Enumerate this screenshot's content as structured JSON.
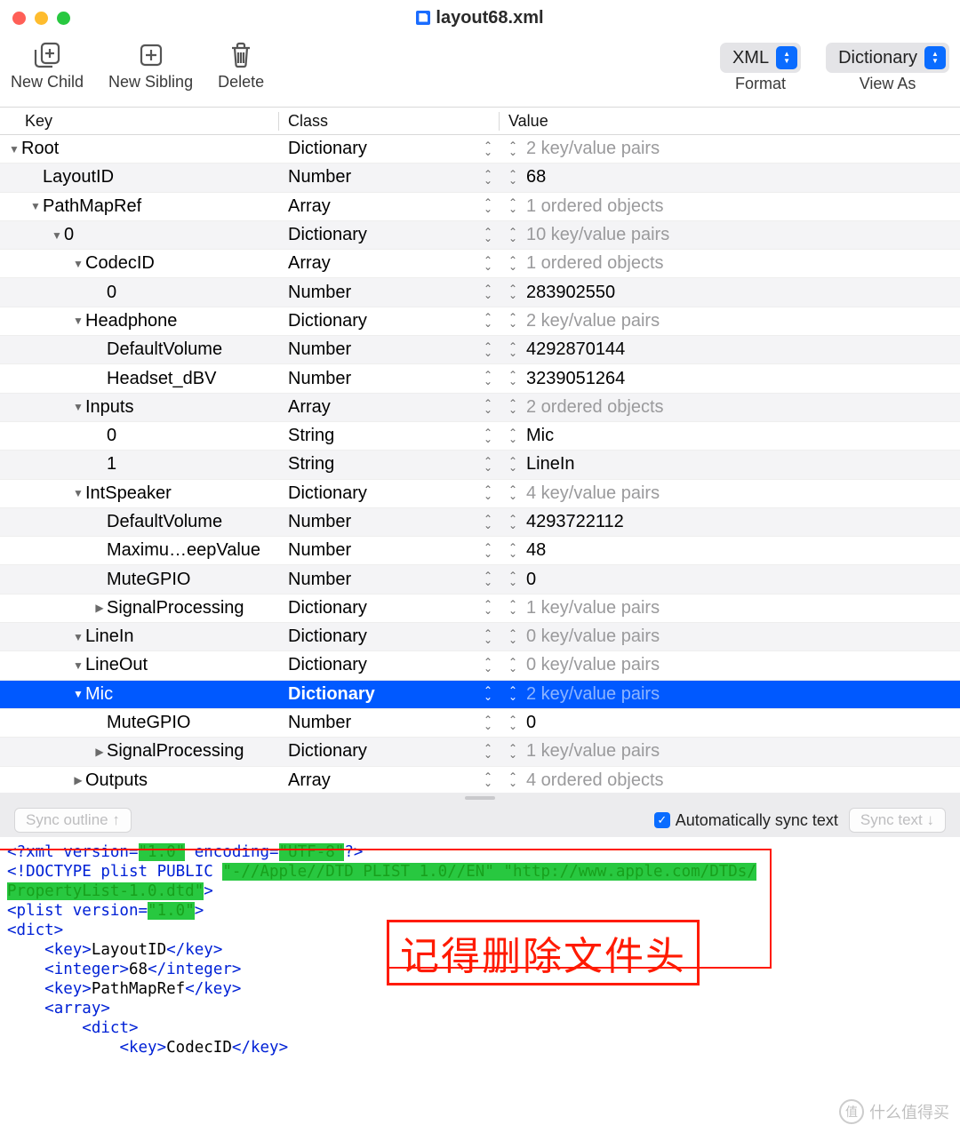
{
  "window": {
    "title": "layout68.xml"
  },
  "toolbar": {
    "new_child": "New Child",
    "new_sibling": "New Sibling",
    "delete": "Delete",
    "format_label": "Format",
    "format_value": "XML",
    "viewas_label": "View As",
    "viewas_value": "Dictionary"
  },
  "columns": {
    "key": "Key",
    "class": "Class",
    "value": "Value"
  },
  "rows": [
    {
      "indent": 0,
      "disclosure": "down",
      "key": "Root",
      "class": "Dictionary",
      "value": "2 key/value pairs",
      "muted": true,
      "selected": false
    },
    {
      "indent": 1,
      "disclosure": "",
      "key": "LayoutID",
      "class": "Number",
      "value": "68",
      "muted": false,
      "selected": false
    },
    {
      "indent": 1,
      "disclosure": "down",
      "key": "PathMapRef",
      "class": "Array",
      "value": "1 ordered objects",
      "muted": true,
      "selected": false
    },
    {
      "indent": 2,
      "disclosure": "down",
      "key": "0",
      "class": "Dictionary",
      "value": "10 key/value pairs",
      "muted": true,
      "selected": false
    },
    {
      "indent": 3,
      "disclosure": "down",
      "key": "CodecID",
      "class": "Array",
      "value": "1 ordered objects",
      "muted": true,
      "selected": false
    },
    {
      "indent": 4,
      "disclosure": "",
      "key": "0",
      "class": "Number",
      "value": "283902550",
      "muted": false,
      "selected": false
    },
    {
      "indent": 3,
      "disclosure": "down",
      "key": "Headphone",
      "class": "Dictionary",
      "value": "2 key/value pairs",
      "muted": true,
      "selected": false
    },
    {
      "indent": 4,
      "disclosure": "",
      "key": "DefaultVolume",
      "class": "Number",
      "value": "4292870144",
      "muted": false,
      "selected": false
    },
    {
      "indent": 4,
      "disclosure": "",
      "key": "Headset_dBV",
      "class": "Number",
      "value": "3239051264",
      "muted": false,
      "selected": false
    },
    {
      "indent": 3,
      "disclosure": "down",
      "key": "Inputs",
      "class": "Array",
      "value": "2 ordered objects",
      "muted": true,
      "selected": false
    },
    {
      "indent": 4,
      "disclosure": "",
      "key": "0",
      "class": "String",
      "value": "Mic",
      "muted": false,
      "selected": false
    },
    {
      "indent": 4,
      "disclosure": "",
      "key": "1",
      "class": "String",
      "value": "LineIn",
      "muted": false,
      "selected": false
    },
    {
      "indent": 3,
      "disclosure": "down",
      "key": "IntSpeaker",
      "class": "Dictionary",
      "value": "4 key/value pairs",
      "muted": true,
      "selected": false
    },
    {
      "indent": 4,
      "disclosure": "",
      "key": "DefaultVolume",
      "class": "Number",
      "value": "4293722112",
      "muted": false,
      "selected": false
    },
    {
      "indent": 4,
      "disclosure": "",
      "key": "Maximu…eepValue",
      "class": "Number",
      "value": "48",
      "muted": false,
      "selected": false
    },
    {
      "indent": 4,
      "disclosure": "",
      "key": "MuteGPIO",
      "class": "Number",
      "value": "0",
      "muted": false,
      "selected": false
    },
    {
      "indent": 4,
      "disclosure": "right",
      "key": "SignalProcessing",
      "class": "Dictionary",
      "value": "1 key/value pairs",
      "muted": true,
      "selected": false
    },
    {
      "indent": 3,
      "disclosure": "down",
      "key": "LineIn",
      "class": "Dictionary",
      "value": "0 key/value pairs",
      "muted": true,
      "selected": false
    },
    {
      "indent": 3,
      "disclosure": "down",
      "key": "LineOut",
      "class": "Dictionary",
      "value": "0 key/value pairs",
      "muted": true,
      "selected": false
    },
    {
      "indent": 3,
      "disclosure": "down",
      "key": "Mic",
      "class": "Dictionary",
      "value": "2 key/value pairs",
      "muted": true,
      "selected": true
    },
    {
      "indent": 4,
      "disclosure": "",
      "key": "MuteGPIO",
      "class": "Number",
      "value": "0",
      "muted": false,
      "selected": false
    },
    {
      "indent": 4,
      "disclosure": "right",
      "key": "SignalProcessing",
      "class": "Dictionary",
      "value": "1 key/value pairs",
      "muted": true,
      "selected": false
    },
    {
      "indent": 3,
      "disclosure": "right",
      "key": "Outputs",
      "class": "Array",
      "value": "4 ordered objects",
      "muted": true,
      "selected": false
    }
  ],
  "sync_bar": {
    "sync_outline": "Sync outline ↑",
    "auto_label": "Automatically sync text",
    "auto_checked": true,
    "sync_text": "Sync text ↓"
  },
  "code_lines": [
    {
      "parts": [
        {
          "c": "blue",
          "t": "<?xml version="
        },
        {
          "c": "green",
          "t": "\"1.0\""
        },
        {
          "c": "blue",
          "t": " encoding="
        },
        {
          "c": "green",
          "t": "\"UTF-8\""
        },
        {
          "c": "blue",
          "t": "?>"
        }
      ]
    },
    {
      "parts": [
        {
          "c": "blue",
          "t": "<!DOCTYPE plist PUBLIC "
        },
        {
          "c": "green",
          "t": "\"-//Apple//DTD PLIST 1.0//EN\" \"http://www.apple.com/DTDs/"
        }
      ]
    },
    {
      "parts": [
        {
          "c": "green",
          "t": "PropertyList-1.0.dtd\""
        },
        {
          "c": "blue",
          "t": ">"
        }
      ]
    },
    {
      "parts": [
        {
          "c": "blue",
          "t": "<plist version="
        },
        {
          "c": "green",
          "t": "\"1.0\""
        },
        {
          "c": "blue",
          "t": ">"
        }
      ]
    },
    {
      "parts": [
        {
          "c": "blue",
          "t": "<dict>"
        }
      ]
    },
    {
      "parts": [
        {
          "c": "black",
          "t": "    "
        },
        {
          "c": "blue",
          "t": "<key>"
        },
        {
          "c": "black",
          "t": "LayoutID"
        },
        {
          "c": "blue",
          "t": "</key>"
        }
      ]
    },
    {
      "parts": [
        {
          "c": "black",
          "t": "    "
        },
        {
          "c": "blue",
          "t": "<integer>"
        },
        {
          "c": "black",
          "t": "68"
        },
        {
          "c": "blue",
          "t": "</integer>"
        }
      ]
    },
    {
      "parts": [
        {
          "c": "black",
          "t": "    "
        },
        {
          "c": "blue",
          "t": "<key>"
        },
        {
          "c": "black",
          "t": "PathMapRef"
        },
        {
          "c": "blue",
          "t": "</key>"
        }
      ]
    },
    {
      "parts": [
        {
          "c": "black",
          "t": "    "
        },
        {
          "c": "blue",
          "t": "<array>"
        }
      ]
    },
    {
      "parts": [
        {
          "c": "black",
          "t": "        "
        },
        {
          "c": "blue",
          "t": "<dict>"
        }
      ]
    },
    {
      "parts": [
        {
          "c": "black",
          "t": "            "
        },
        {
          "c": "blue",
          "t": "<key>"
        },
        {
          "c": "black",
          "t": "CodecID"
        },
        {
          "c": "blue",
          "t": "</key>"
        }
      ]
    }
  ],
  "annotation": {
    "text": "记得删除文件头"
  },
  "watermark": {
    "text": "什么值得买",
    "badge": "值"
  }
}
